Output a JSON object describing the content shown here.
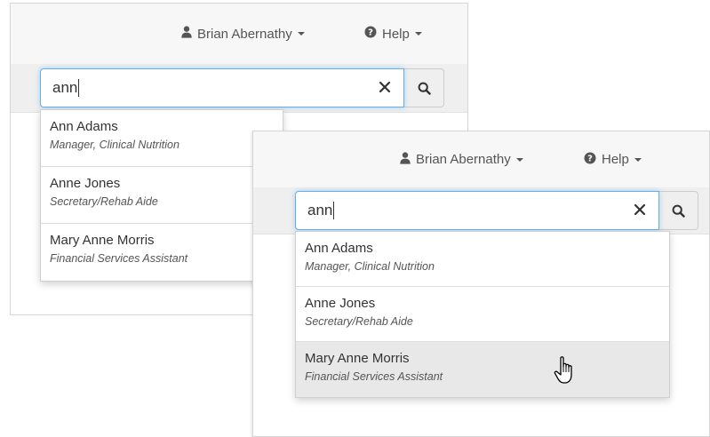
{
  "screens": [
    {
      "navbar": {
        "user_menu_label": "Brian Abernathy",
        "user_icon": "user-icon",
        "help_menu_label": "Help",
        "help_icon": "question-circle-icon"
      },
      "search": {
        "value": "ann",
        "clear_icon": "close-icon",
        "submit_icon": "search-icon"
      },
      "results": [
        {
          "name": "Ann Adams",
          "title": "Manager, Clinical Nutrition"
        },
        {
          "name": "Anne Jones",
          "title": "Secretary/Rehab Aide"
        },
        {
          "name": "Mary Anne Morris",
          "title": "Financial Services Assistant"
        }
      ]
    },
    {
      "navbar": {
        "user_menu_label": "Brian Abernathy",
        "user_icon": "user-icon",
        "help_menu_label": "Help",
        "help_icon": "question-circle-icon"
      },
      "search": {
        "value": "ann",
        "clear_icon": "close-icon",
        "submit_icon": "search-icon"
      },
      "results": [
        {
          "name": "Ann Adams",
          "title": "Manager, Clinical Nutrition"
        },
        {
          "name": "Anne Jones",
          "title": "Secretary/Rehab Aide"
        },
        {
          "name": "Mary Anne Morris",
          "title": "Financial Services Assistant",
          "hovered": true
        }
      ],
      "pointer_icon": "hand-pointer-icon"
    }
  ],
  "colors": {
    "navbar_bg": "#f7f7f7",
    "search_band_bg": "#efefef",
    "focus_border": "#66afe9",
    "hover_bg": "#e8e8e8",
    "text": "#333333",
    "muted_text": "#555555"
  }
}
